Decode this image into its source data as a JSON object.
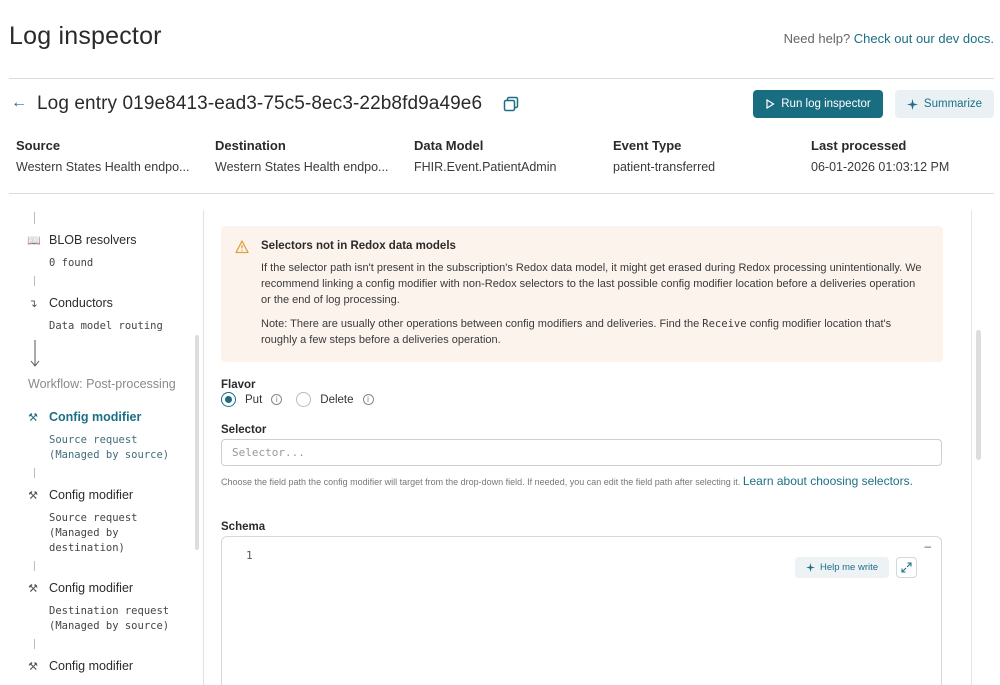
{
  "header": {
    "title": "Log inspector",
    "help_prefix": "Need help?",
    "help_link": "Check out our dev docs."
  },
  "entry": {
    "title": "Log entry 019e8413-ead3-75c5-8ec3-22b8fd9a49e6",
    "run_label": "Run log inspector",
    "summarize_label": "Summarize"
  },
  "meta": [
    {
      "label": "Source",
      "value": "Western States Health endpo..."
    },
    {
      "label": "Destination",
      "value": "Western States Health endpo..."
    },
    {
      "label": "Data Model",
      "value": "FHIR.Event.PatientAdmin"
    },
    {
      "label": "Event Type",
      "value": "patient-transferred"
    },
    {
      "label": "Last processed",
      "value": "06-01-2026 01:03:12 PM"
    }
  ],
  "sidebar": {
    "items": [
      {
        "label": "BLOB resolvers",
        "sub": "0 found"
      },
      {
        "label": "Conductors",
        "sub": "Data model routing"
      },
      {
        "label": "Config modifier",
        "sub": "Source request\n(Managed by source)"
      },
      {
        "label": "Config modifier",
        "sub": "Source request\n(Managed by\ndestination)"
      },
      {
        "label": "Config modifier",
        "sub": "Destination request\n(Managed by source)"
      },
      {
        "label": "Config modifier",
        "sub": ""
      }
    ],
    "section": "Workflow: Post-processing"
  },
  "warning": {
    "title": "Selectors not in Redox data models",
    "para1": "If the selector path isn't present in the subscription's Redox data model, it might get erased during Redox processing unintentionally. We recommend linking a config modifier with non-Redox selectors to the last possible config modifier location before a deliveries operation or the end of log processing.",
    "para2_a": "Note: There are usually other operations between config modifiers and deliveries. Find the ",
    "para2_code": "Receive",
    "para2_b": " config modifier location that's roughly a few steps before a deliveries operation."
  },
  "flavor": {
    "label": "Flavor",
    "option_put": "Put",
    "option_delete": "Delete"
  },
  "selector": {
    "label": "Selector",
    "placeholder": "Selector...",
    "helper": "Choose the field path the config modifier will target from the drop-down field. If needed, you can edit the field path after selecting it.",
    "helper_link": "Learn about choosing selectors."
  },
  "schema": {
    "label": "Schema",
    "line_number": "1",
    "help_write_label": "Help me write"
  },
  "colors": {
    "accent": "#186d80",
    "link": "#1c6f85",
    "warning_bg": "#fdf3ed",
    "warning_icon": "#e0a03a"
  }
}
